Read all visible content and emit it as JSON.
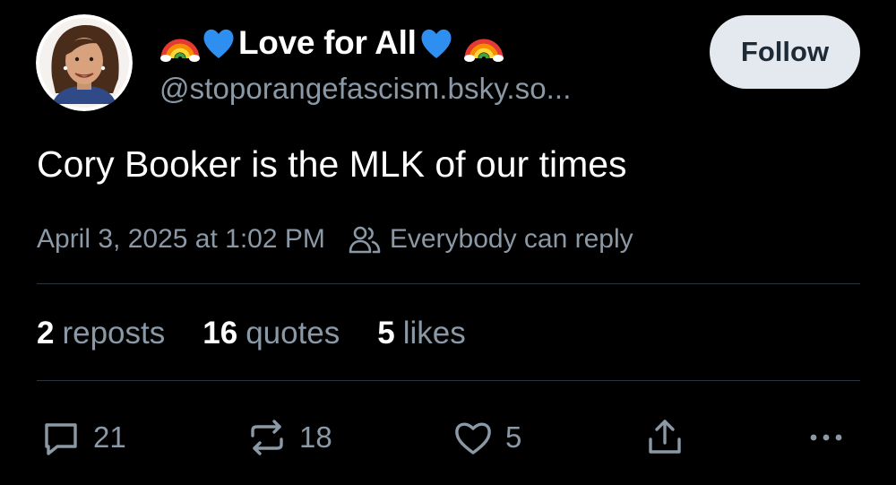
{
  "profile": {
    "display_name": "Love for All",
    "handle": "@stoporangefascism.bsky.so...",
    "name_emojis": [
      "rainbow",
      "blue-heart",
      "blue-heart",
      "rainbow"
    ]
  },
  "follow_label": "Follow",
  "post": {
    "text": "Cory Booker is the MLK of our times",
    "timestamp": "April 3, 2025 at 1:02 PM",
    "reply_setting": "Everybody can reply"
  },
  "stats": {
    "reposts": {
      "count": "2",
      "label": "reposts"
    },
    "quotes": {
      "count": "16",
      "label": "quotes"
    },
    "likes": {
      "count": "5",
      "label": "likes"
    }
  },
  "actions": {
    "reply_count": "21",
    "repost_count": "18",
    "like_count": "5"
  },
  "colors": {
    "background": "#000000",
    "text": "#ffffff",
    "muted": "#8b98a5",
    "divider": "#2a3340",
    "follow_bg": "#e3e9ef",
    "follow_text": "#1e2a36"
  }
}
